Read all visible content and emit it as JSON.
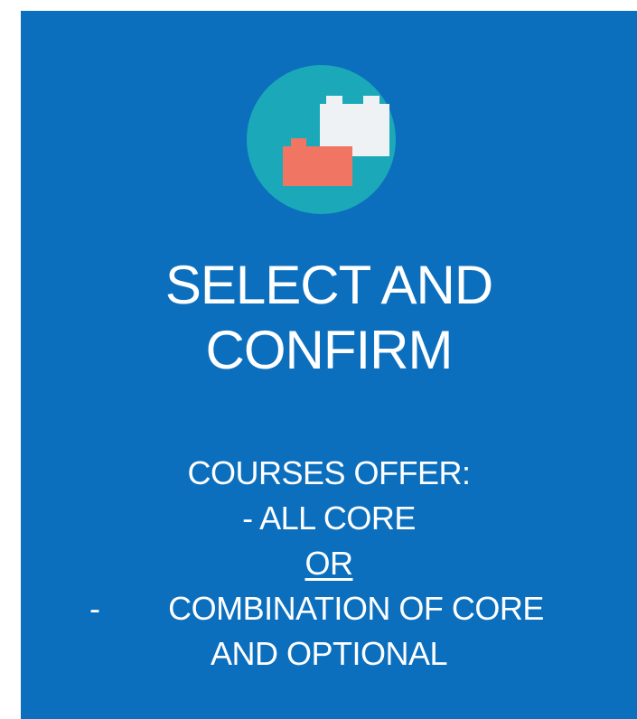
{
  "slide": {
    "title_line1": "SELECT AND",
    "title_line2": "CONFIRM",
    "body": {
      "line1": "COURSES OFFER:",
      "line2": "- ALL CORE",
      "line3": "OR",
      "line4_bullet": "-",
      "line4": "COMBINATION OF CORE",
      "line5": "AND OPTIONAL"
    },
    "icon": "building-blocks-icon",
    "colors": {
      "background": "#0b6fbe",
      "icon_circle": "#1ba9b9",
      "block_white": "#eef2f4",
      "block_red": "#f07562",
      "text": "#ffffff"
    }
  }
}
